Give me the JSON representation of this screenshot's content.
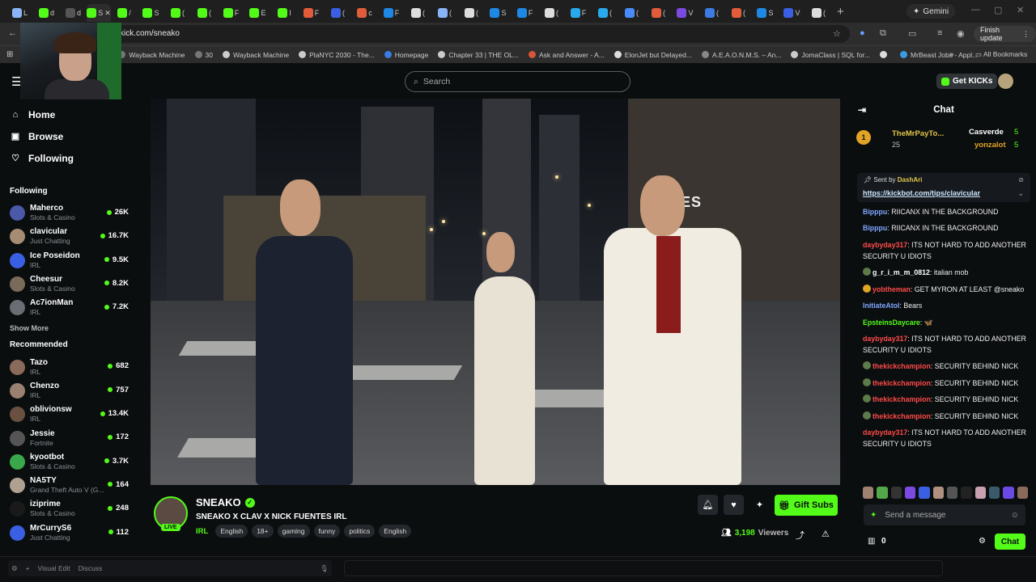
{
  "browser": {
    "url": "kick.com/sneako",
    "gemini_label": "Gemini",
    "finish_update": "Finish update",
    "tabs": [
      {
        "label": "L",
        "color": "#8ab4f8"
      },
      {
        "label": "d",
        "color": "#53fc18"
      },
      {
        "label": "d",
        "color": "#555"
      },
      {
        "label": "S",
        "color": "#53fc18",
        "active": true
      },
      {
        "label": "/",
        "color": "#53fc18"
      },
      {
        "label": "S",
        "color": "#53fc18"
      },
      {
        "label": "(",
        "color": "#53fc18"
      },
      {
        "label": "(",
        "color": "#53fc18"
      },
      {
        "label": "F",
        "color": "#53fc18"
      },
      {
        "label": "E",
        "color": "#53fc18"
      },
      {
        "label": "I",
        "color": "#53fc18"
      },
      {
        "label": "F",
        "color": "#e25c3b"
      },
      {
        "label": "(",
        "color": "#3b5fe2"
      },
      {
        "label": "c",
        "color": "#e25c3b"
      },
      {
        "label": "F",
        "color": "#1e88e5"
      },
      {
        "label": "(",
        "color": "#ddd"
      },
      {
        "label": "(",
        "color": "#8ab4f8"
      },
      {
        "label": "(",
        "color": "#ddd"
      },
      {
        "label": "S",
        "color": "#1e88e5"
      },
      {
        "label": "F",
        "color": "#1e88e5"
      },
      {
        "label": "(",
        "color": "#ddd"
      },
      {
        "label": "F",
        "color": "#29a9eb"
      },
      {
        "label": "(",
        "color": "#29a9eb"
      },
      {
        "label": "(",
        "color": "#4a8cf7"
      },
      {
        "label": "(",
        "color": "#e25c3b"
      },
      {
        "label": "V",
        "color": "#7b4ae2"
      },
      {
        "label": "(",
        "color": "#3b7be2"
      },
      {
        "label": "(",
        "color": "#e25c3b"
      },
      {
        "label": "S",
        "color": "#1e88e5"
      },
      {
        "label": "V",
        "color": "#3b5fe2"
      },
      {
        "label": "(",
        "color": "#ddd"
      }
    ],
    "bookmarks": [
      {
        "label": "Wayback Machine",
        "color": "#777"
      },
      {
        "label": "30",
        "color": "#777"
      },
      {
        "label": "Wayback Machine",
        "color": "#ccc"
      },
      {
        "label": "PlaNYC 2030 - The...",
        "color": "#ccc"
      },
      {
        "label": "Homepage",
        "color": "#3b7be2"
      },
      {
        "label": "Chapter 33 | THE OL...",
        "color": "#ccc"
      },
      {
        "label": "Ask and Answer - A...",
        "color": "#d8543b"
      },
      {
        "label": "ElonJet but Delayed...",
        "color": "#ddd"
      },
      {
        "label": "A.E.A.O.N.M.S. – An...",
        "color": "#888"
      },
      {
        "label": "JomaClass | SQL for...",
        "color": "#ccc"
      },
      {
        "label": "",
        "color": "#ddd"
      },
      {
        "label": "MrBeast Jobs - Appl...",
        "color": "#3b9be2"
      }
    ],
    "all_bookmarks": "All Bookmarks"
  },
  "topnav": {
    "search_placeholder": "Search",
    "get_kicks": "Get KICKs"
  },
  "sidebar": {
    "nav": [
      {
        "label": "Home",
        "icon": "⌂",
        "name": "home"
      },
      {
        "label": "Browse",
        "icon": "▣",
        "name": "browse"
      },
      {
        "label": "Following",
        "icon": "♡",
        "name": "following"
      }
    ],
    "following_title": "Following",
    "following": [
      {
        "name": "Maherco",
        "category": "Slots & Casino",
        "viewers": "26K",
        "color": "#4a5aa8"
      },
      {
        "name": "clavicular",
        "category": "Just Chatting",
        "viewers": "16.7K",
        "color": "#a78c74"
      },
      {
        "name": "Ice Poseidon",
        "category": "IRL",
        "viewers": "9.5K",
        "color": "#3b5fe2"
      },
      {
        "name": "Cheesur",
        "category": "Slots & Casino",
        "viewers": "8.2K",
        "color": "#7a6a5a"
      },
      {
        "name": "Ac7ionMan",
        "category": "IRL",
        "viewers": "7.2K",
        "color": "#6a6e74"
      }
    ],
    "show_more": "Show More",
    "recommended_title": "Recommended",
    "recommended": [
      {
        "name": "Tazo",
        "category": "IRL",
        "viewers": "682",
        "color": "#8a6a5a"
      },
      {
        "name": "Chenzo",
        "category": "IRL",
        "viewers": "757",
        "color": "#9a8070"
      },
      {
        "name": "oblivionsw",
        "category": "IRL",
        "viewers": "13.4K",
        "color": "#6a5040"
      },
      {
        "name": "Jessie",
        "category": "Fortnite",
        "viewers": "172",
        "color": "#555"
      },
      {
        "name": "kyootbot",
        "category": "Slots & Casino",
        "viewers": "3.7K",
        "color": "#3aa84a"
      },
      {
        "name": "NA5TY",
        "category": "Grand Theft Auto V (G...",
        "viewers": "164",
        "color": "#b0a090"
      },
      {
        "name": "iziprime",
        "category": "Slots & Casino",
        "viewers": "248",
        "color": "#1a1a1a"
      },
      {
        "name": "MrCurryS6",
        "category": "Just Chatting",
        "viewers": "112",
        "color": "#3b5fe2"
      }
    ]
  },
  "stream": {
    "streamer": "SNEAKO",
    "live_label": "LIVE",
    "title": "SNEAKO X CLAV X NICK FUENTES IRL",
    "category": "IRL",
    "tags": [
      "English",
      "18+",
      "gaming",
      "funny",
      "politics",
      "English"
    ],
    "gift_subs": "Gift Subs",
    "viewer_count": "3,198",
    "viewers_label": "Viewers",
    "video_sign": "XIES"
  },
  "chat": {
    "title": "Chat",
    "leaderboard": [
      {
        "name": "TheMrPayTo...",
        "count": "25"
      },
      {
        "name": "Casverde",
        "count": "5"
      },
      {
        "name": "yonzalot",
        "count": "5"
      }
    ],
    "rank": "1",
    "pinned_by_label": "Sent by",
    "pinned_by": "DashAri",
    "pinned_link": "https://kickbot.com/tips/clavicular",
    "messages": [
      {
        "user": "Bipppu",
        "text": "RIICANX IN THE BACKGROUND",
        "color": "#7fa7ff",
        "badge": ""
      },
      {
        "user": "Bipppu",
        "text": "RIICANX IN THE BACKGROUND",
        "color": "#7fa7ff",
        "badge": ""
      },
      {
        "user": "daybyday317",
        "text": "ITS NOT HARD TO ADD ANOTHER SECURITY U IDIOTS",
        "color": "#ff4a4a",
        "badge": ""
      },
      {
        "user": "g_r_i_m_m_0812",
        "text": "italian mob",
        "color": "#ffffff",
        "badge": "#5c7a4a"
      },
      {
        "user": "yobtheman",
        "text": "GET MYRON AT LEAST @sneako",
        "color": "#ff4a4a",
        "badge": "#e1a425"
      },
      {
        "user": "InitiateAtol",
        "text": "Bears",
        "color": "#7fa7ff",
        "badge": ""
      },
      {
        "user": "EpsteinsDaycare",
        "text": "🦋",
        "color": "#53fc18",
        "badge": ""
      },
      {
        "user": "daybyday317",
        "text": "ITS NOT HARD TO ADD ANOTHER SECURITY U IDIOTS",
        "color": "#ff4a4a",
        "badge": ""
      },
      {
        "user": "thekickchampion",
        "text": "SECURITY BEHIND NICK",
        "color": "#ff4a4a",
        "badge": "#5c7a4a"
      },
      {
        "user": "thekickchampion",
        "text": "SECURITY BEHIND NICK",
        "color": "#ff4a4a",
        "badge": "#5c7a4a"
      },
      {
        "user": "thekickchampion",
        "text": "SECURITY BEHIND NICK",
        "color": "#ff4a4a",
        "badge": "#5c7a4a"
      },
      {
        "user": "thekickchampion",
        "text": "SECURITY BEHIND NICK",
        "color": "#ff4a4a",
        "badge": "#5c7a4a"
      },
      {
        "user": "daybyday317",
        "text": "ITS NOT HARD TO ADD ANOTHER SECURITY U IDIOTS",
        "color": "#ff4a4a",
        "badge": ""
      }
    ],
    "input_placeholder": "Send a message",
    "kicks_count": "0",
    "chat_button": "Chat"
  },
  "devbar": {
    "visual_edit": "Visual Edit",
    "discuss": "Discuss"
  },
  "colors": {
    "accent": "#53fc18",
    "background": "#0b0e0f"
  }
}
